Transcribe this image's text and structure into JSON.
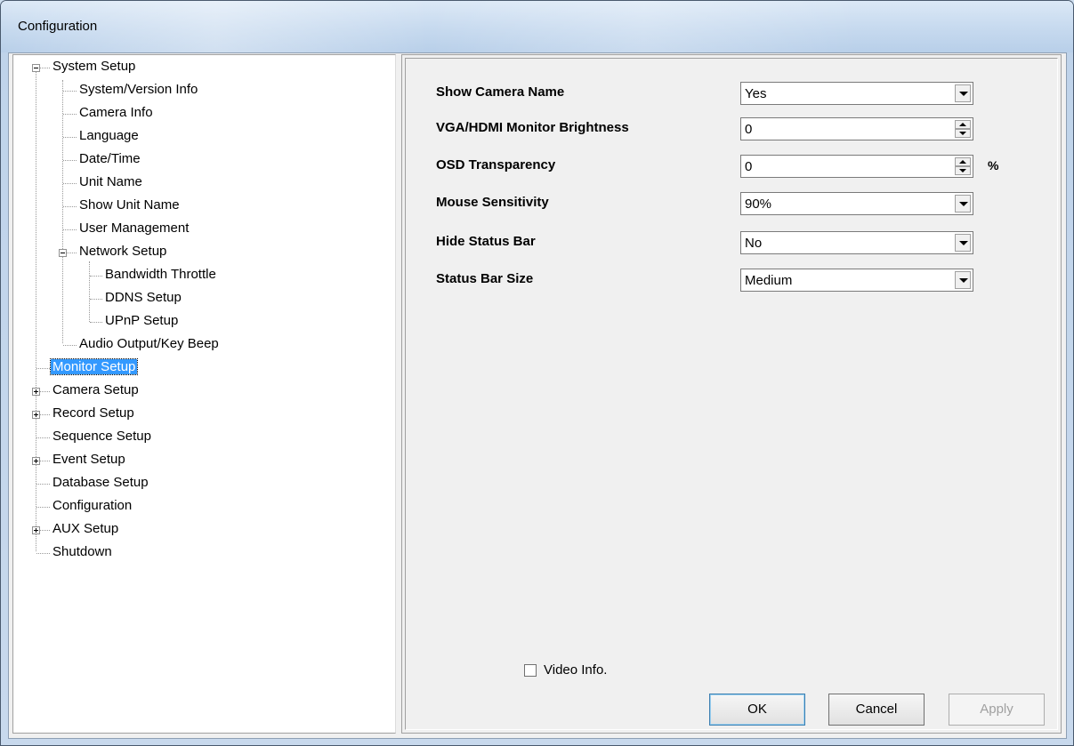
{
  "window": {
    "title": "Configuration"
  },
  "tree": [
    {
      "label": "System Setup",
      "expand": "minus"
    },
    {
      "label": "System/Version Info"
    },
    {
      "label": "Camera Info"
    },
    {
      "label": "Language"
    },
    {
      "label": "Date/Time"
    },
    {
      "label": "Unit Name"
    },
    {
      "label": "Show Unit Name"
    },
    {
      "label": "User Management"
    },
    {
      "label": "Network Setup",
      "expand": "minus"
    },
    {
      "label": "Bandwidth Throttle"
    },
    {
      "label": "DDNS Setup"
    },
    {
      "label": "UPnP Setup"
    },
    {
      "label": "Audio Output/Key Beep"
    },
    {
      "label": "Monitor Setup",
      "selected": true
    },
    {
      "label": "Camera Setup",
      "expand": "plus"
    },
    {
      "label": "Record Setup",
      "expand": "plus"
    },
    {
      "label": "Sequence Setup"
    },
    {
      "label": "Event Setup",
      "expand": "plus"
    },
    {
      "label": "Database Setup"
    },
    {
      "label": "Configuration"
    },
    {
      "label": "AUX Setup",
      "expand": "plus"
    },
    {
      "label": "Shutdown"
    }
  ],
  "settings": {
    "show_camera_name": {
      "label": "Show Camera Name",
      "value": "Yes",
      "control": "dropdown"
    },
    "brightness": {
      "label": "VGA/HDMI Monitor Brightness",
      "value": "0",
      "control": "spinner"
    },
    "osd_transparency": {
      "label": "OSD Transparency",
      "value": "0",
      "control": "spinner",
      "unit": "%"
    },
    "mouse_sensitivity": {
      "label": "Mouse Sensitivity",
      "value": "90%",
      "control": "dropdown"
    },
    "hide_status_bar": {
      "label": "Hide Status Bar",
      "value": "No",
      "control": "dropdown"
    },
    "status_bar_size": {
      "label": "Status Bar Size",
      "value": "Medium",
      "control": "dropdown"
    }
  },
  "video_info": {
    "label": "Video Info.",
    "checked": false
  },
  "buttons": {
    "ok": "OK",
    "cancel": "Cancel",
    "apply": "Apply"
  },
  "colors": {
    "selection": "#3399ff",
    "face": "#f0f0f0"
  }
}
